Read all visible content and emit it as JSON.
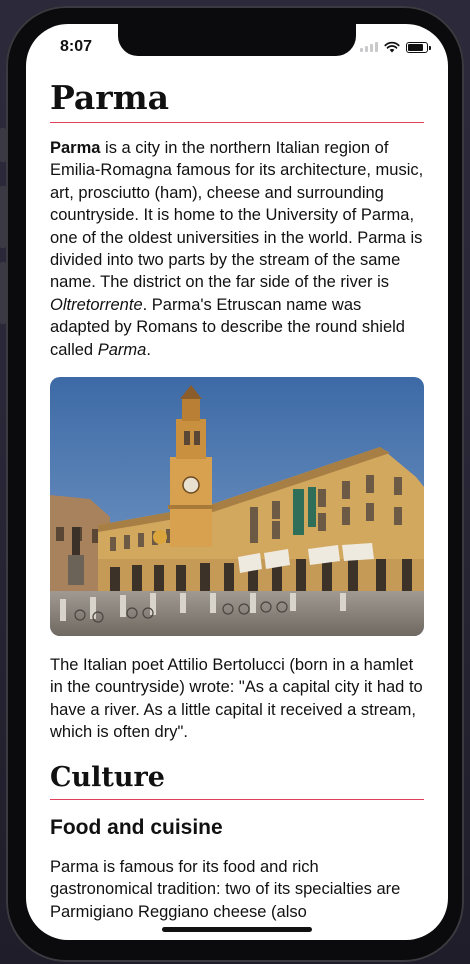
{
  "status_bar": {
    "time": "8:07"
  },
  "article": {
    "title": "Parma",
    "intro": {
      "bold_lead": "Parma",
      "text_1": " is a city in the northern Italian region of Emilia-Romagna famous for its architecture, music, art, prosciutto (ham), cheese and surrounding countryside. It is home to the University of Parma, one of the oldest universities in the world. Parma is divided into two parts by the stream of the same name. The district on the far side of the river is ",
      "italic_1": "Oltretorrente",
      "text_2": ". Parma's Etruscan name was adapted by Romans to describe the round shield called ",
      "italic_2": "Parma",
      "text_3": "."
    },
    "quote_paragraph": "The Italian poet Attilio Bertolucci (born in a hamlet in the countryside) wrote: \"As a capital city it had to have a river. As a little capital it received a stream, which is often dry\".",
    "section_title": "Culture",
    "subsection_title": "Food and cuisine",
    "food_paragraph": "Parma is famous for its food and rich gastronomical tradition: two of its specialties are Parmigiano Reggiano cheese (also"
  },
  "colors": {
    "accent_rule": "#e2405a",
    "text": "#111111",
    "background": "#ffffff"
  },
  "icons": [
    "cellular-signal-icon",
    "wifi-icon",
    "battery-icon"
  ]
}
